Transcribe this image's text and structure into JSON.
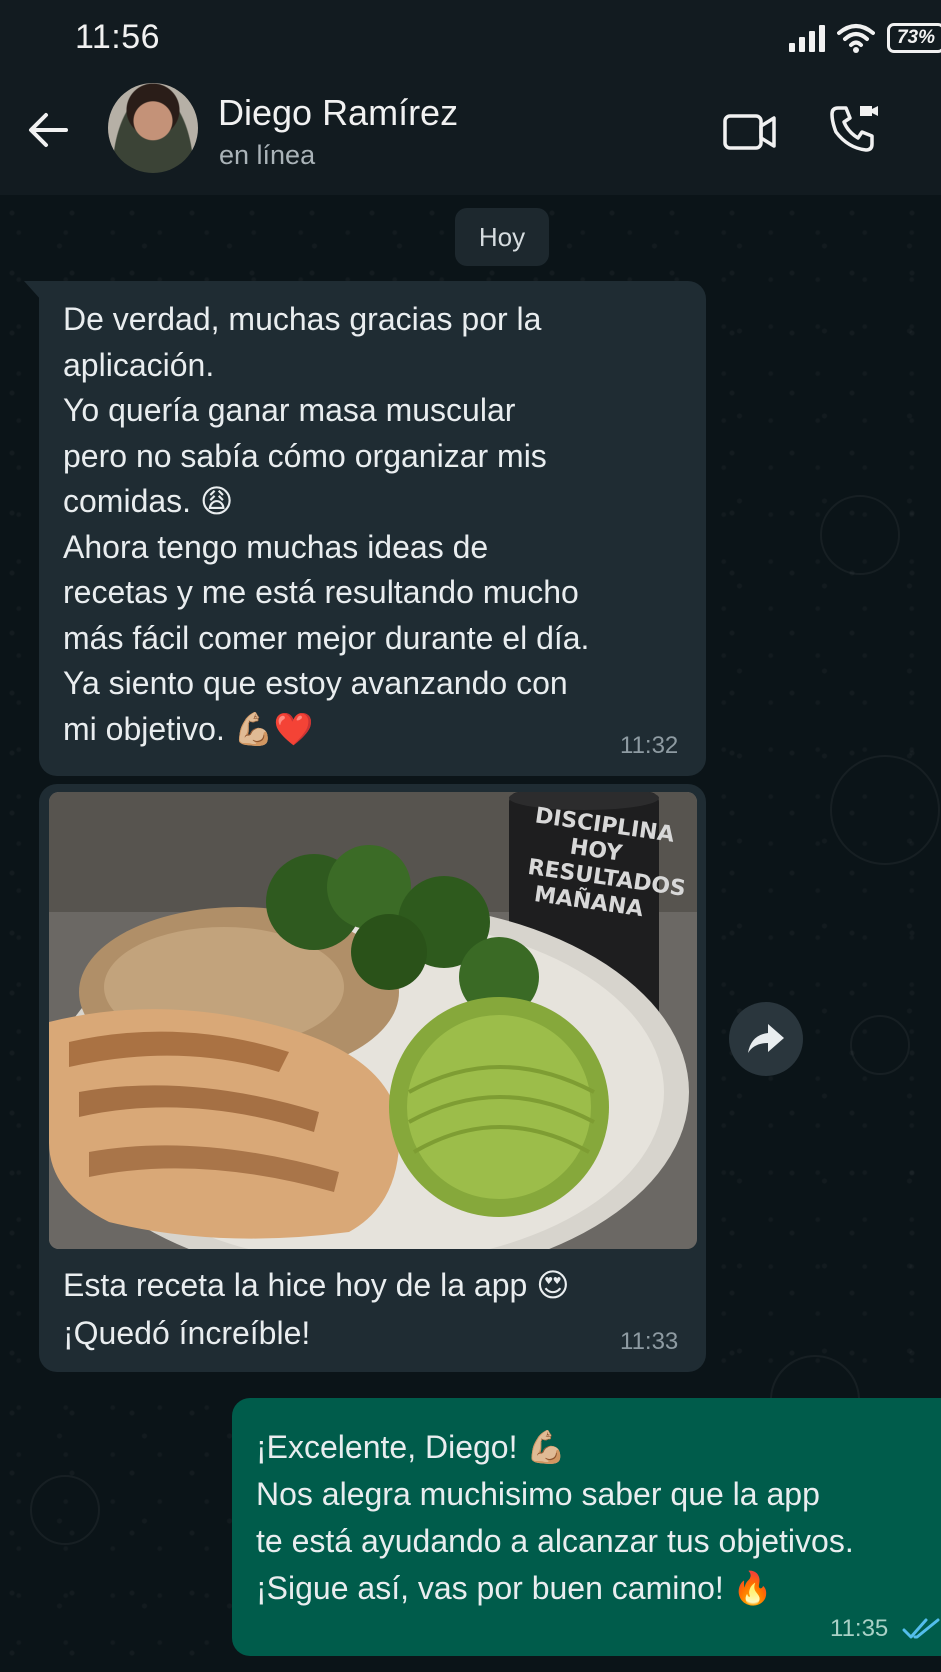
{
  "status_bar": {
    "time": "11:56",
    "battery": "73%"
  },
  "header": {
    "contact_name": "Diego Ramírez",
    "contact_status": "en línea",
    "icons": [
      "back-arrow-icon",
      "video-call-icon",
      "voice-call-icon"
    ]
  },
  "chat": {
    "date_label": "Hoy",
    "messages": [
      {
        "direction": "incoming",
        "lines": [
          "De verdad, muchas gracias por la",
          "aplicación.",
          "Yo quería ganar masa muscular",
          "pero no sabía cómo organizar mis",
          "comidas. 😩",
          "Ahora tengo muchas ideas de",
          "recetas y me está resultando mucho",
          "más fácil comer mejor durante el día.",
          "Ya siento que estoy avanzando con",
          "mi objetivo. 💪🏼❤️"
        ],
        "time": "11:32"
      },
      {
        "direction": "incoming",
        "image": {
          "description_icon": "food-photo",
          "mug_text_1": "DISCIPLINA",
          "mug_text_2": "HOY",
          "mug_text_3": "RESULTADOS",
          "mug_text_4": "MAÑANA"
        },
        "lines": [
          "Esta receta la hice hoy de la app 😍",
          "¡Quedó íncreíble!"
        ],
        "time": "11:33"
      },
      {
        "direction": "outgoing",
        "lines": [
          "¡Excelente, Diego! 💪🏼",
          "Nos alegra muchisimo saber que la app",
          "te está ayudando a alcanzar tus objetivos.",
          "¡Sigue así, vas por buen camino! 🔥"
        ],
        "time": "11:35",
        "read_status": "read-ticks"
      }
    ]
  },
  "colors": {
    "background": "#0b1418",
    "header": "#121b20",
    "incoming_bubble": "#1f2c33",
    "outgoing_bubble": "#005c4b",
    "read_ticks": "#53bdeb"
  }
}
